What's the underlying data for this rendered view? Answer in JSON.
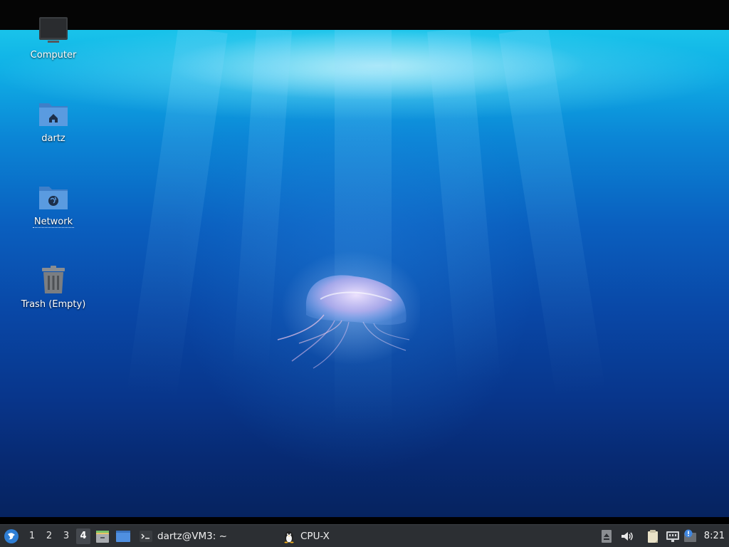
{
  "desktop": {
    "icons": [
      {
        "label": "Computer",
        "icon": "monitor-icon"
      },
      {
        "label": "dartz",
        "icon": "home-folder-icon"
      },
      {
        "label": "Network",
        "icon": "network-folder-icon"
      },
      {
        "label": "Trash (Empty)",
        "icon": "trash-icon"
      }
    ]
  },
  "taskbar": {
    "menu_icon": "application-menu-icon",
    "workspaces": [
      "1",
      "2",
      "3",
      "4"
    ],
    "active_workspace": "4",
    "launchers": [
      {
        "icon": "file-manager-icon"
      },
      {
        "icon": "show-desktop-icon"
      }
    ],
    "tasks": [
      {
        "label": "dartz@VM3: ~",
        "icon": "terminal-icon"
      },
      {
        "label": "CPU-X",
        "icon": "tux-icon"
      }
    ],
    "tray": [
      {
        "icon": "eject-icon"
      },
      {
        "icon": "volume-icon"
      },
      {
        "icon": "clipboard-icon"
      },
      {
        "icon": "network-wired-icon"
      },
      {
        "icon": "update-notifier-icon"
      }
    ],
    "clock": "8:21"
  },
  "colors": {
    "taskbar_bg": "#2c2f33",
    "folder_blue": "#5a9be0",
    "water_top": "#19c3ea",
    "water_bottom": "#06235f"
  }
}
